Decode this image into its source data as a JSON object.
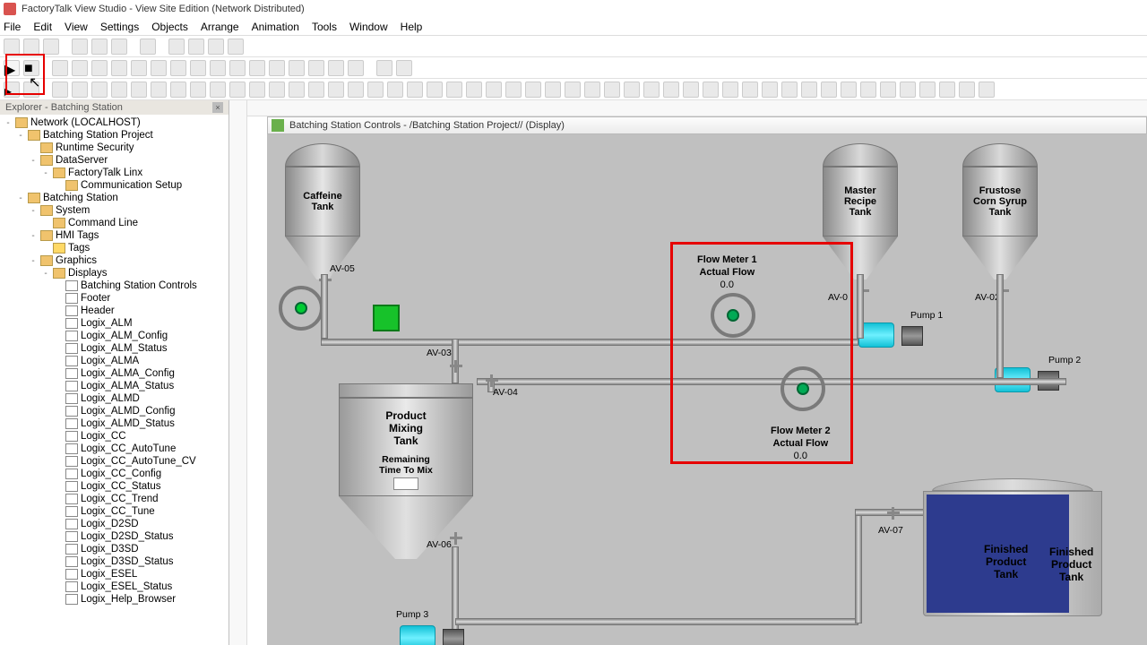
{
  "title": "FactoryTalk View Studio - View Site Edition (Network Distributed)",
  "menu": [
    "File",
    "Edit",
    "View",
    "Settings",
    "Objects",
    "Arrange",
    "Animation",
    "Tools",
    "Window",
    "Help"
  ],
  "explorer": {
    "title": "Explorer - Batching Station",
    "items": [
      {
        "ind": 0,
        "exp": "-",
        "icon": "net",
        "label": "Network (LOCALHOST)"
      },
      {
        "ind": 1,
        "exp": "-",
        "icon": "proj",
        "label": "Batching Station Project"
      },
      {
        "ind": 2,
        "exp": "",
        "icon": "sec",
        "label": "Runtime Security"
      },
      {
        "ind": 2,
        "exp": "-",
        "icon": "srv",
        "label": "DataServer"
      },
      {
        "ind": 3,
        "exp": "-",
        "icon": "linx",
        "label": "FactoryTalk Linx"
      },
      {
        "ind": 4,
        "exp": "",
        "icon": "comm",
        "label": "Communication Setup"
      },
      {
        "ind": 1,
        "exp": "-",
        "icon": "hmi",
        "label": "Batching Station"
      },
      {
        "ind": 2,
        "exp": "-",
        "icon": "sys",
        "label": "System"
      },
      {
        "ind": 3,
        "exp": "",
        "icon": "cmd",
        "label": "Command Line"
      },
      {
        "ind": 2,
        "exp": "-",
        "icon": "tags",
        "label": "HMI Tags"
      },
      {
        "ind": 3,
        "exp": "",
        "icon": "tag",
        "label": "Tags"
      },
      {
        "ind": 2,
        "exp": "-",
        "icon": "gfx",
        "label": "Graphics"
      },
      {
        "ind": 3,
        "exp": "-",
        "icon": "disp",
        "label": "Displays"
      },
      {
        "ind": 4,
        "exp": "",
        "icon": "display",
        "label": "Batching Station Controls"
      },
      {
        "ind": 4,
        "exp": "",
        "icon": "display",
        "label": "Footer"
      },
      {
        "ind": 4,
        "exp": "",
        "icon": "display",
        "label": "Header"
      },
      {
        "ind": 4,
        "exp": "",
        "icon": "display",
        "label": "Logix_ALM"
      },
      {
        "ind": 4,
        "exp": "",
        "icon": "display",
        "label": "Logix_ALM_Config"
      },
      {
        "ind": 4,
        "exp": "",
        "icon": "display",
        "label": "Logix_ALM_Status"
      },
      {
        "ind": 4,
        "exp": "",
        "icon": "display",
        "label": "Logix_ALMA"
      },
      {
        "ind": 4,
        "exp": "",
        "icon": "display",
        "label": "Logix_ALMA_Config"
      },
      {
        "ind": 4,
        "exp": "",
        "icon": "display",
        "label": "Logix_ALMA_Status"
      },
      {
        "ind": 4,
        "exp": "",
        "icon": "display",
        "label": "Logix_ALMD"
      },
      {
        "ind": 4,
        "exp": "",
        "icon": "display",
        "label": "Logix_ALMD_Config"
      },
      {
        "ind": 4,
        "exp": "",
        "icon": "display",
        "label": "Logix_ALMD_Status"
      },
      {
        "ind": 4,
        "exp": "",
        "icon": "display",
        "label": "Logix_CC"
      },
      {
        "ind": 4,
        "exp": "",
        "icon": "display",
        "label": "Logix_CC_AutoTune"
      },
      {
        "ind": 4,
        "exp": "",
        "icon": "display",
        "label": "Logix_CC_AutoTune_CV"
      },
      {
        "ind": 4,
        "exp": "",
        "icon": "display",
        "label": "Logix_CC_Config"
      },
      {
        "ind": 4,
        "exp": "",
        "icon": "display",
        "label": "Logix_CC_Status"
      },
      {
        "ind": 4,
        "exp": "",
        "icon": "display",
        "label": "Logix_CC_Trend"
      },
      {
        "ind": 4,
        "exp": "",
        "icon": "display",
        "label": "Logix_CC_Tune"
      },
      {
        "ind": 4,
        "exp": "",
        "icon": "display",
        "label": "Logix_D2SD"
      },
      {
        "ind": 4,
        "exp": "",
        "icon": "display",
        "label": "Logix_D2SD_Status"
      },
      {
        "ind": 4,
        "exp": "",
        "icon": "display",
        "label": "Logix_D3SD"
      },
      {
        "ind": 4,
        "exp": "",
        "icon": "display",
        "label": "Logix_D3SD_Status"
      },
      {
        "ind": 4,
        "exp": "",
        "icon": "display",
        "label": "Logix_ESEL"
      },
      {
        "ind": 4,
        "exp": "",
        "icon": "display",
        "label": "Logix_ESEL_Status"
      },
      {
        "ind": 4,
        "exp": "",
        "icon": "display",
        "label": "Logix_Help_Browser"
      }
    ]
  },
  "display": {
    "title": "Batching Station Controls - /Batching Station Project// (Display)",
    "tanks": {
      "caffeine": "Caffeine\nTank",
      "master": "Master\nRecipe\nTank",
      "frustose": "Frustose\nCorn Syrup\nTank",
      "product_mix": "Product\nMixing\nTank",
      "remaining": "Remaining\nTime To Mix",
      "finished": "Finished\nProduct\nTank"
    },
    "valves": {
      "av01": "AV-0",
      "av02": "AV-02",
      "av03": "AV-03",
      "av04": "AV-04",
      "av05": "AV-05",
      "av06": "AV-06",
      "av07": "AV-07"
    },
    "flow": {
      "m1": {
        "title": "Flow Meter 1",
        "sub": "Actual Flow",
        "val": "0.0"
      },
      "m2": {
        "title": "Flow Meter 2",
        "sub": "Actual Flow",
        "val": "0.0"
      }
    },
    "pumps": {
      "p1": "Pump 1",
      "p2": "Pump 2",
      "p3": "Pump 3"
    }
  }
}
